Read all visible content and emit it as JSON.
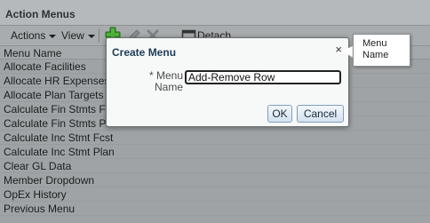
{
  "panel": {
    "title": "Action Menus",
    "toolbar": {
      "actions_label": "Actions",
      "view_label": "View",
      "detach_label": "Detach",
      "icons": [
        "add-icon",
        "edit-icon",
        "delete-icon",
        "detach-icon"
      ]
    },
    "column_header": "Menu Name",
    "rows": [
      "Allocate Facilities",
      "Allocate HR Expenses",
      "Allocate Plan Targets",
      "Calculate Fin Stmts Fcst",
      "Calculate Fin Stmts Plan",
      "Calculate Inc Stmt Fcst",
      "Calculate Inc Stmt Plan",
      "Clear GL Data",
      "Member Dropdown",
      "OpEx History",
      "Previous Menu"
    ]
  },
  "dialog": {
    "title": "Create Menu",
    "close_glyph": "×",
    "field_label_required": "*",
    "field_label_line1": "Menu",
    "field_label_line2": "Name",
    "field_value": "Add-Remove Row",
    "ok_label": "OK",
    "cancel_label": "Cancel"
  },
  "note": {
    "line1": "Menu",
    "line2": "Name"
  },
  "colors": {
    "add_icon": "#3a9a2a",
    "dialog_title": "#1c3b5a",
    "button_border": "#7e9fbf"
  }
}
